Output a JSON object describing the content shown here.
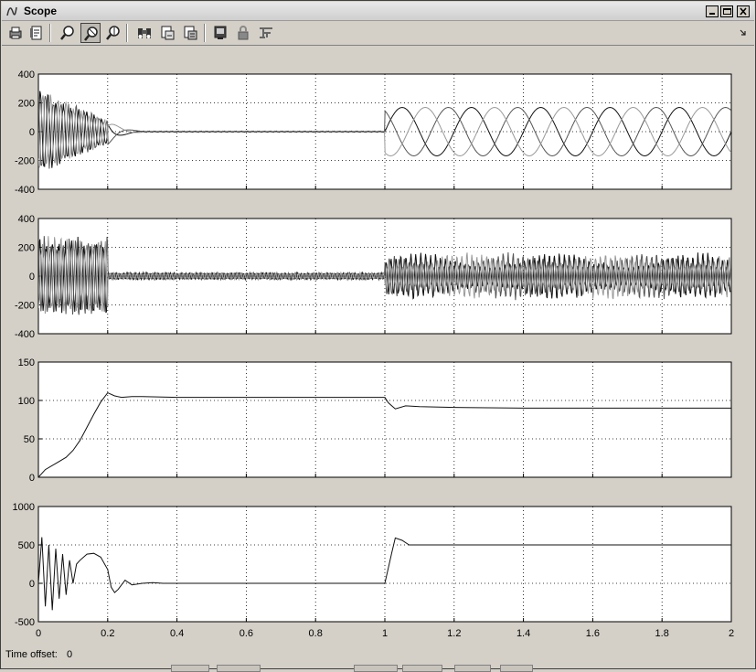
{
  "window": {
    "title": "Scope",
    "icon": "scope-app-icon",
    "controls": [
      "minimize-icon",
      "maximize-icon",
      "close-icon"
    ]
  },
  "toolbar": {
    "buttons": [
      {
        "name": "print-button",
        "icon": "printer-icon",
        "active": false
      },
      {
        "name": "parameters-button",
        "icon": "parameters-icon",
        "active": false
      },
      {
        "name": "zoom-button",
        "icon": "zoom-icon",
        "active": false
      },
      {
        "name": "zoom-x-button",
        "icon": "zoom-x-icon",
        "active": true
      },
      {
        "name": "zoom-y-button",
        "icon": "zoom-y-icon",
        "active": false
      },
      {
        "name": "autoscale-button",
        "icon": "binoculars-icon",
        "active": false
      },
      {
        "name": "save-axes-button",
        "icon": "save-axes-icon",
        "active": false
      },
      {
        "name": "restore-axes-button",
        "icon": "restore-axes-icon",
        "active": false
      },
      {
        "name": "floating-scope-button",
        "icon": "floating-scope-icon",
        "active": false
      },
      {
        "name": "lock-axes-button",
        "icon": "lock-icon",
        "active": false
      },
      {
        "name": "signal-selection-button",
        "icon": "signal-selection-icon",
        "active": false
      }
    ]
  },
  "status": {
    "time_offset_label": "Time offset:",
    "time_offset_value": "0"
  },
  "chart_data": [
    {
      "type": "line",
      "title": "",
      "xlabel": "",
      "ylabel": "",
      "xlim": [
        0,
        2
      ],
      "ylim": [
        -400,
        400
      ],
      "yticks": [
        -400,
        -200,
        0,
        200,
        400
      ],
      "grid": true,
      "series": [
        {
          "color": "#111111",
          "description": "three-phase signal, transient oscillation up to ~0.2, near zero until 1.0, then sinusoid amplitude ~170 period ~0.2",
          "phase": 0
        },
        {
          "color": "#555555",
          "phase": 2.094
        },
        {
          "color": "#999999",
          "phase": 4.189
        }
      ]
    },
    {
      "type": "line",
      "title": "",
      "xlabel": "",
      "ylabel": "",
      "xlim": [
        0,
        2
      ],
      "ylim": [
        -400,
        400
      ],
      "yticks": [
        -400,
        -200,
        0,
        200,
        400
      ],
      "grid": true,
      "series": [
        {
          "color": "#111111",
          "phase": 0
        },
        {
          "color": "#555555",
          "phase": 2.094
        },
        {
          "color": "#999999",
          "phase": 4.189
        }
      ]
    },
    {
      "type": "line",
      "title": "",
      "xlabel": "",
      "ylabel": "",
      "xlim": [
        0,
        2
      ],
      "ylim": [
        0,
        150
      ],
      "yticks": [
        0,
        50,
        100,
        150
      ],
      "grid": true,
      "series": [
        {
          "color": "#111111",
          "x": [
            0,
            0.02,
            0.05,
            0.08,
            0.1,
            0.12,
            0.14,
            0.16,
            0.18,
            0.2,
            0.22,
            0.24,
            0.27,
            0.3,
            0.4,
            0.6,
            0.8,
            1.0,
            1.01,
            1.03,
            1.06,
            1.1,
            1.2,
            1.4,
            1.6,
            1.8,
            2.0
          ],
          "y": [
            0,
            10,
            18,
            26,
            35,
            48,
            65,
            82,
            98,
            110,
            106,
            104,
            105,
            105,
            104,
            104,
            104,
            104,
            97,
            89,
            93,
            92,
            91,
            90,
            90,
            90,
            90
          ]
        }
      ]
    },
    {
      "type": "line",
      "title": "",
      "xlabel": "",
      "ylabel": "",
      "xlim": [
        0,
        2
      ],
      "ylim": [
        -500,
        1000
      ],
      "yticks": [
        -500,
        0,
        500,
        1000
      ],
      "xticks": [
        0,
        0.2,
        0.4,
        0.6,
        0.8,
        1,
        1.2,
        1.4,
        1.6,
        1.8,
        2
      ],
      "grid": true,
      "series": [
        {
          "color": "#111111",
          "x": [
            0,
            0.01,
            0.02,
            0.03,
            0.04,
            0.05,
            0.06,
            0.07,
            0.08,
            0.09,
            0.1,
            0.11,
            0.12,
            0.14,
            0.16,
            0.18,
            0.2,
            0.21,
            0.22,
            0.23,
            0.25,
            0.27,
            0.3,
            0.33,
            0.36,
            0.4,
            0.6,
            0.8,
            0.99,
            1.0,
            1.02,
            1.03,
            1.05,
            1.07,
            1.1,
            1.2,
            1.4,
            1.6,
            1.8,
            2.0
          ],
          "y": [
            0,
            600,
            -300,
            500,
            -350,
            450,
            -200,
            380,
            -150,
            300,
            0,
            250,
            300,
            380,
            390,
            340,
            180,
            -50,
            -120,
            -80,
            40,
            -20,
            0,
            10,
            0,
            0,
            0,
            0,
            0,
            0,
            400,
            590,
            560,
            500,
            500,
            500,
            500,
            500,
            500,
            500
          ]
        }
      ]
    }
  ]
}
